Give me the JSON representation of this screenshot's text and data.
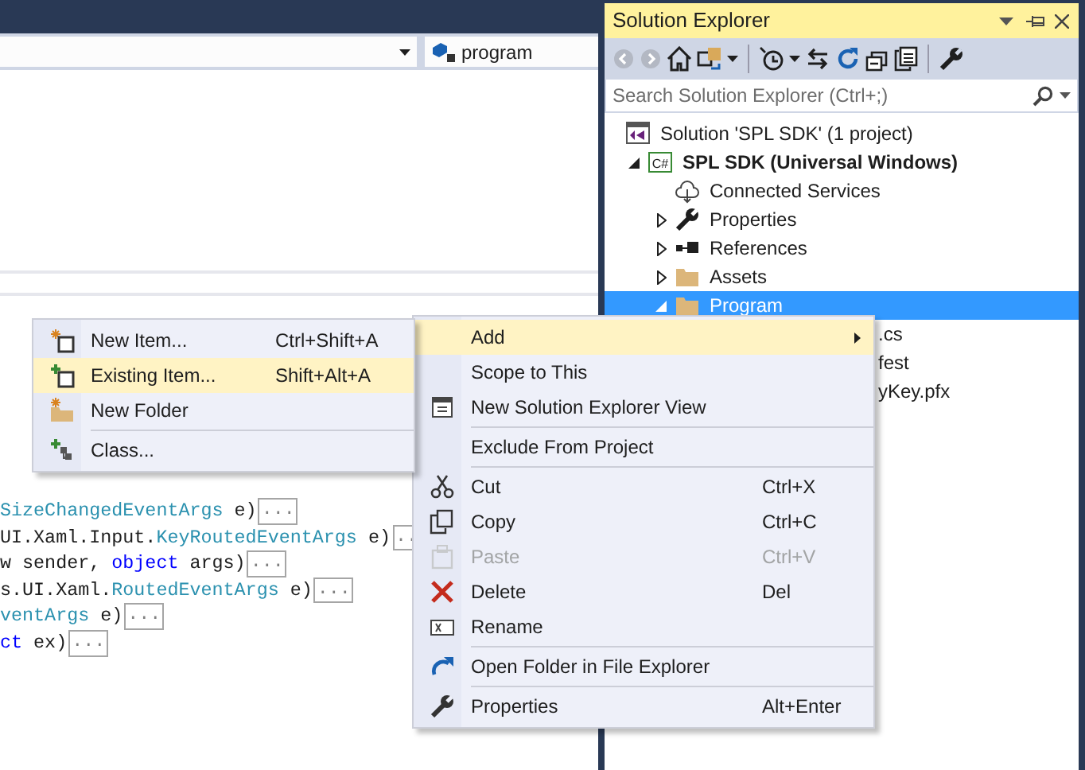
{
  "editor": {
    "navigation": {
      "right_combo": "program"
    },
    "code_lines": [
      {
        "segments": [
          {
            "kind": "type",
            "text": "SizeChangedEventArgs"
          },
          {
            "kind": "plain",
            "text": " e)"
          }
        ],
        "collapsed": "..."
      },
      {
        "segments": [
          {
            "kind": "plain",
            "text": "UI.Xaml.Input."
          },
          {
            "kind": "type",
            "text": "KeyRoutedEventArgs"
          },
          {
            "kind": "plain",
            "text": " e)"
          }
        ],
        "collapsed": ".."
      },
      {
        "segments": [
          {
            "kind": "plain",
            "text": "w sender, "
          },
          {
            "kind": "keyword",
            "text": "object"
          },
          {
            "kind": "plain",
            "text": " args)"
          }
        ],
        "collapsed": "..."
      },
      {
        "segments": [
          {
            "kind": "plain",
            "text": "s.UI.Xaml."
          },
          {
            "kind": "type",
            "text": "RoutedEventArgs"
          },
          {
            "kind": "plain",
            "text": " e)"
          }
        ],
        "collapsed": "..."
      },
      {
        "segments": [
          {
            "kind": "type",
            "text": "ventArgs"
          },
          {
            "kind": "plain",
            "text": " e)"
          }
        ],
        "collapsed": "..."
      },
      {
        "segments": [
          {
            "kind": "keyword",
            "text": "ct"
          },
          {
            "kind": "plain",
            "text": " ex)"
          }
        ],
        "collapsed": "..."
      }
    ]
  },
  "solution_explorer": {
    "title": "Solution Explorer",
    "toolbar": [
      {
        "disabled": true
      },
      {
        "disabled": true
      },
      {
        "disabled": false
      },
      {
        "disabled": false
      },
      {
        "disabled": false
      },
      {
        "disabled": false
      },
      {
        "disabled": false
      },
      {
        "disabled": false
      },
      {
        "disabled": false
      }
    ],
    "search": {
      "placeholder": "Search Solution Explorer (Ctrl+;)"
    },
    "tree": [
      {
        "kind": "solution",
        "label": "Solution 'SPL SDK' (1 project)",
        "selected": false,
        "children": [
          {
            "kind": "project",
            "icon_text": "C#",
            "label": "SPL SDK (Universal Windows)",
            "selected": false,
            "expanded": true,
            "children": [
              {
                "kind": "service",
                "label": "Connected Services",
                "selected": false
              },
              {
                "kind": "properties",
                "label": "Properties",
                "selected": false,
                "expanded": false
              },
              {
                "kind": "references",
                "label": "References",
                "selected": false,
                "expanded": false
              },
              {
                "kind": "folder",
                "label": "Assets",
                "selected": false,
                "expanded": false
              },
              {
                "kind": "folder",
                "label": "Program",
                "selected": true,
                "expanded": true,
                "children": [
                  {
                    "kind": "fragment",
                    "label": ".cs",
                    "selected": false
                  },
                  {
                    "kind": "fragment",
                    "label": "fest",
                    "selected": false
                  },
                  {
                    "kind": "fragment",
                    "label": "yKey.pfx",
                    "selected": false
                  }
                ]
              }
            ]
          }
        ]
      }
    ]
  },
  "context_menu": {
    "items": [
      {
        "kind": "item",
        "label": "Add",
        "selected": true,
        "submenu": true
      },
      {
        "kind": "item",
        "label": "Scope to This",
        "selected": false
      },
      {
        "kind": "item",
        "label": "New Solution Explorer View",
        "selected": false
      },
      {
        "kind": "separator"
      },
      {
        "kind": "item",
        "label": "Exclude From Project",
        "selected": false
      },
      {
        "kind": "separator"
      },
      {
        "kind": "item",
        "label": "Cut",
        "shortcut": "Ctrl+X",
        "selected": false
      },
      {
        "kind": "item",
        "label": "Copy",
        "shortcut": "Ctrl+C",
        "selected": false
      },
      {
        "kind": "item",
        "label": "Paste",
        "shortcut": "Ctrl+V",
        "selected": false,
        "disabled": true
      },
      {
        "kind": "item",
        "label": "Delete",
        "shortcut": "Del",
        "selected": false
      },
      {
        "kind": "item",
        "label": "Rename",
        "selected": false
      },
      {
        "kind": "separator"
      },
      {
        "kind": "item",
        "label": "Open Folder in File Explorer",
        "selected": false
      },
      {
        "kind": "separator"
      },
      {
        "kind": "item",
        "label": "Properties",
        "shortcut": "Alt+Enter",
        "selected": false
      }
    ]
  },
  "add_submenu": {
    "items": [
      {
        "kind": "item",
        "label": "New Item...",
        "shortcut": "Ctrl+Shift+A",
        "selected": false
      },
      {
        "kind": "item",
        "label": "Existing Item...",
        "shortcut": "Shift+Alt+A",
        "selected": true
      },
      {
        "kind": "item",
        "label": "New Folder",
        "selected": false
      },
      {
        "kind": "separator"
      },
      {
        "kind": "item",
        "label": "Class...",
        "selected": false
      }
    ]
  }
}
